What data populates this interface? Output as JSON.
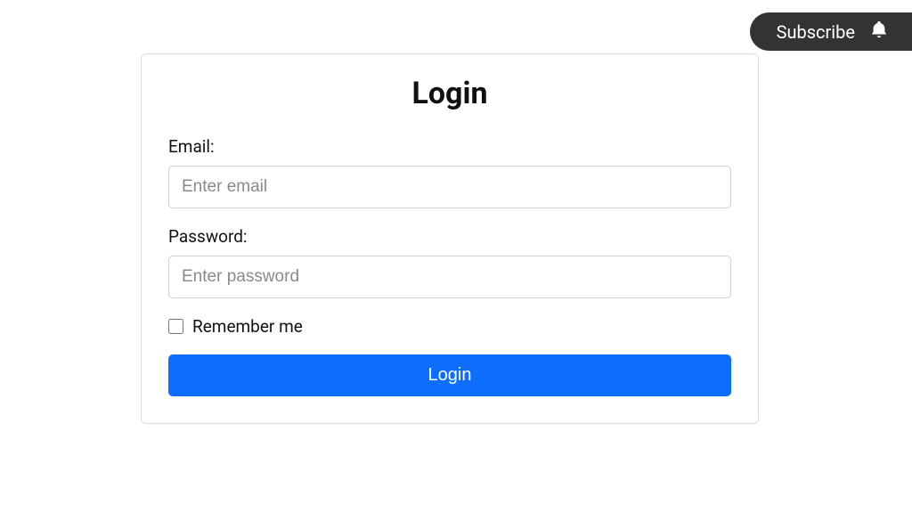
{
  "subscribe": {
    "label": "Subscribe"
  },
  "login": {
    "title": "Login",
    "email_label": "Email:",
    "email_placeholder": "Enter email",
    "password_label": "Password:",
    "password_placeholder": "Enter password",
    "remember_label": "Remember me",
    "submit_label": "Login"
  },
  "colors": {
    "primary": "#0d6efd",
    "pill": "#333333"
  }
}
